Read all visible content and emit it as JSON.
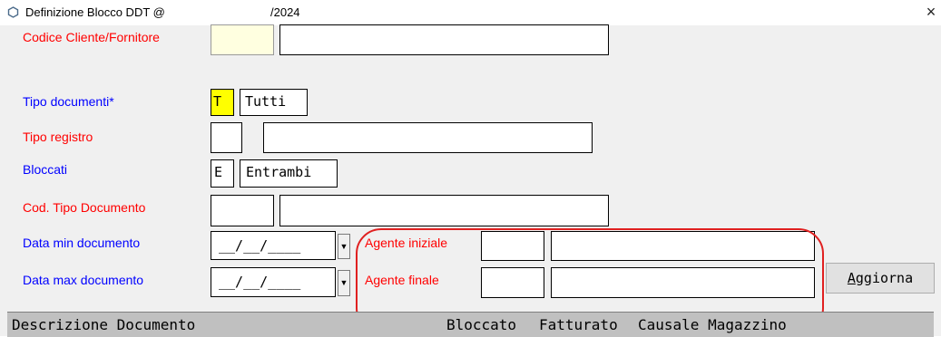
{
  "window": {
    "title": "Definizione Blocco DDT @",
    "title_year": "/2024",
    "close_symbol": "×"
  },
  "fields": {
    "codice_cliente": {
      "label": "Codice Cliente/Fornitore",
      "code": "",
      "desc": ""
    },
    "tipo_documenti": {
      "label": "Tipo documenti*",
      "code": "T",
      "desc": "Tutti"
    },
    "tipo_registro": {
      "label": "Tipo registro",
      "code": "",
      "desc": ""
    },
    "bloccati": {
      "label": "Bloccati",
      "code": "E",
      "desc": "Entrambi"
    },
    "cod_tipo_documento": {
      "label": "Cod. Tipo Documento",
      "code": "",
      "desc": ""
    },
    "data_min": {
      "label": "Data min documento",
      "value": "__/__/____"
    },
    "data_max": {
      "label": "Data max documento",
      "value": "__/__/____"
    },
    "agente_iniziale": {
      "label": "Agente iniziale",
      "code": "",
      "desc": ""
    },
    "agente_finale": {
      "label": "Agente finale",
      "code": "",
      "desc": ""
    }
  },
  "buttons": {
    "aggiorna": "Aggiorna"
  },
  "table": {
    "columns": [
      "Descrizione Documento",
      "Bloccato",
      "Fatturato",
      "Causale Magazzino"
    ]
  },
  "colors": {
    "required_label": "#0000ff",
    "optional_label": "#ff0000",
    "highlight_field": "#ffff00",
    "light_field": "#ffffe0",
    "annotation": "#e02020"
  },
  "icons": {
    "app": "hexagon-icon",
    "combo": "chevron-down-icon",
    "close": "close-icon"
  }
}
